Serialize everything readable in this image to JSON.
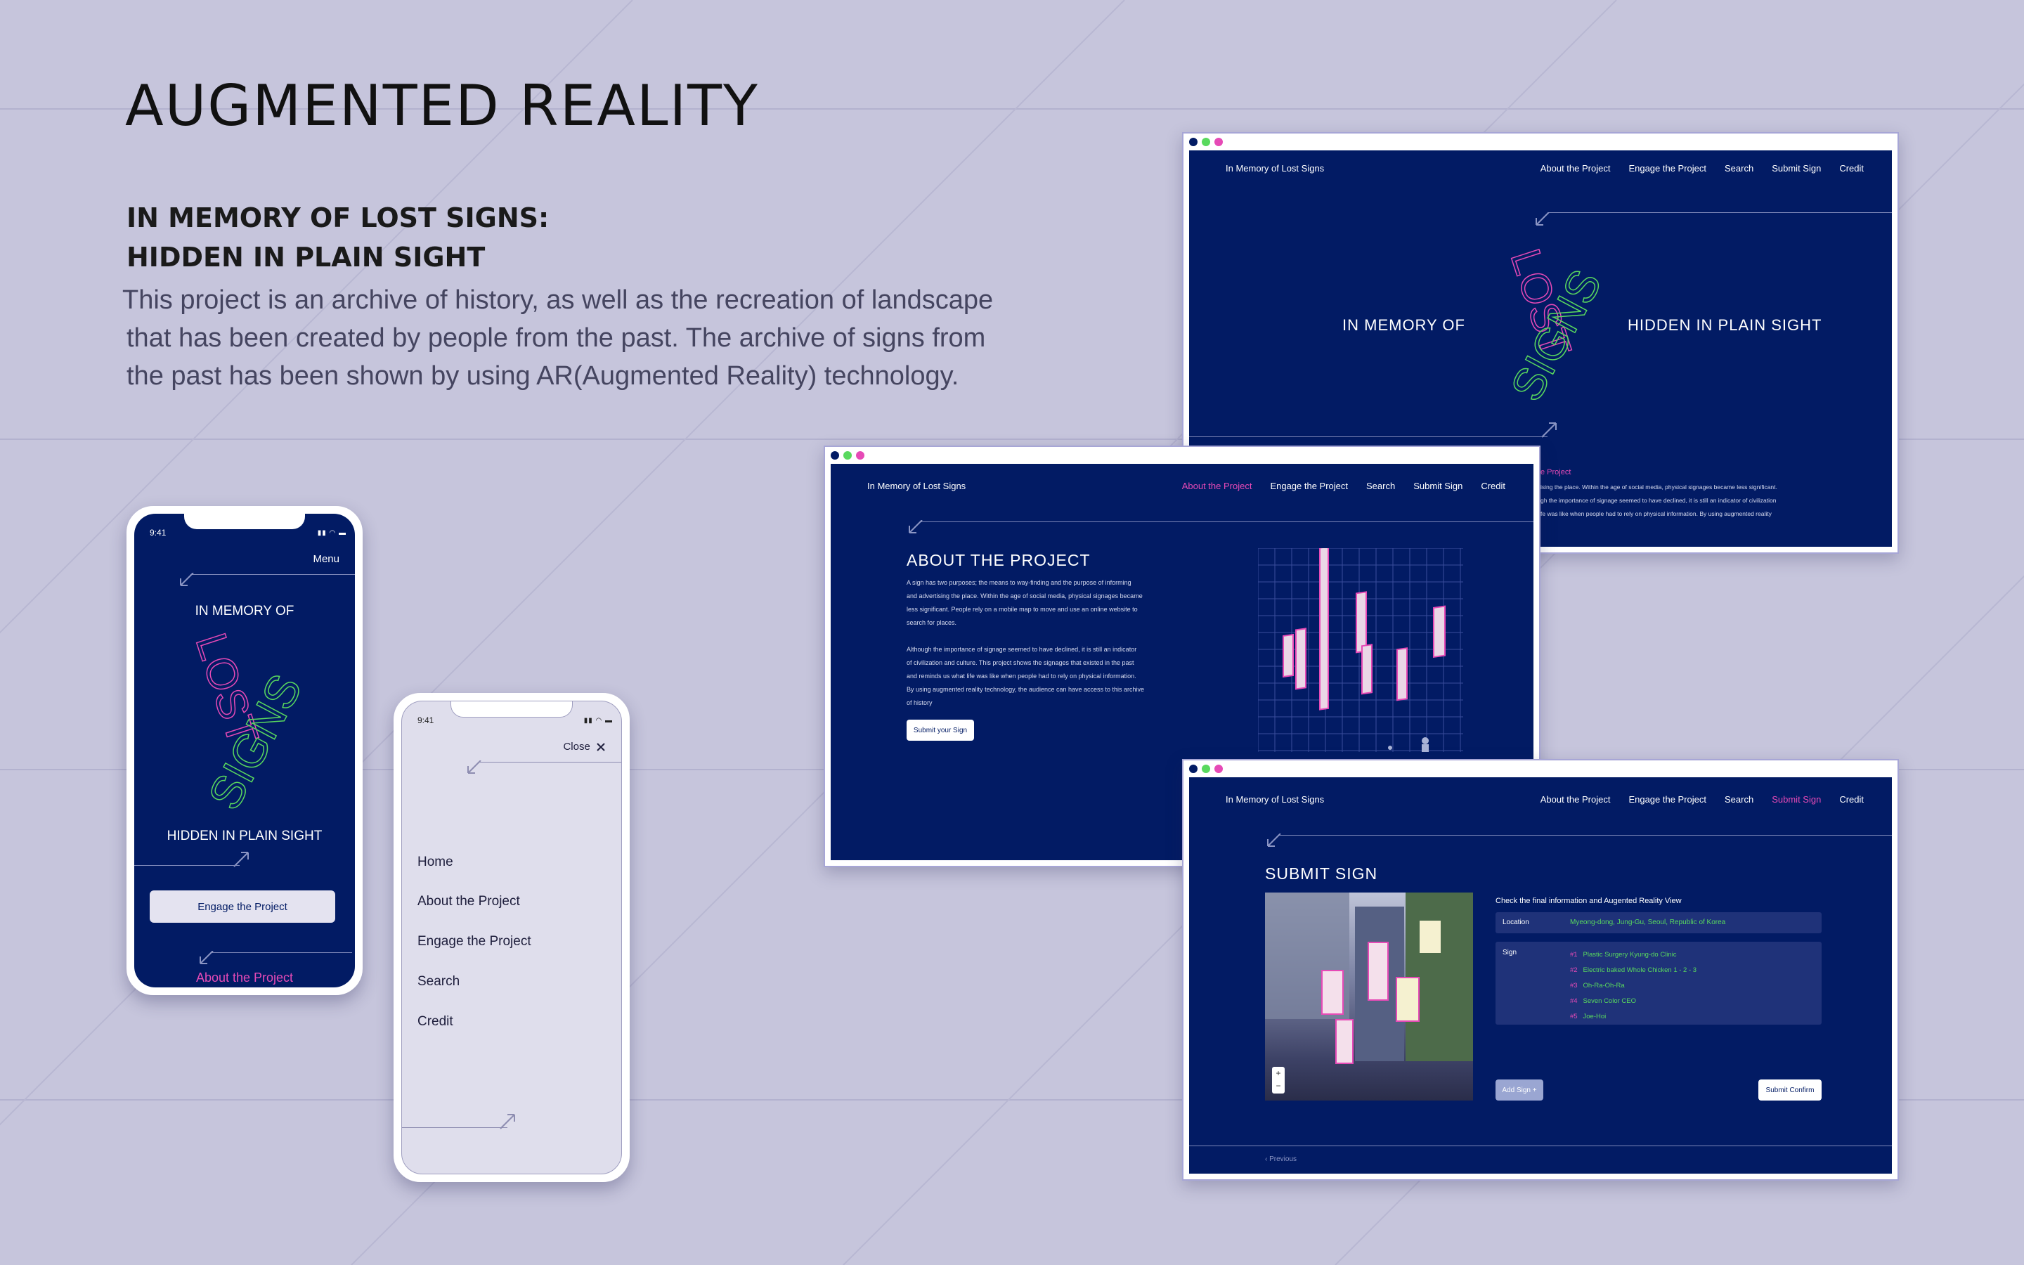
{
  "page": {
    "heading": "AUGMENTED REALITY",
    "subheading_line1": "IN MEMORY OF LOST SIGNS:",
    "subheading_line2": "HIDDEN IN PLAIN SIGHT",
    "description_line1": "This project is an archive of history, as well as the recreation of landscape",
    "description_line2": "that has been created by people from the past. The archive of signs from",
    "description_line3": "the past has been shown by using AR(Augmented Reality) technology."
  },
  "colors": {
    "background": "#c6c5dc",
    "navy": "#021b64",
    "pink": "#e64ab6",
    "green": "#59d95e"
  },
  "nav": {
    "brand": "In Memory of Lost Signs",
    "links": [
      "About the Project",
      "Engage the Project",
      "Search",
      "Submit Sign",
      "Credit"
    ]
  },
  "home_window": {
    "left_title": "IN MEMORY OF",
    "right_title": "HIDDEN IN PLAIN SIGHT",
    "logo_word1": "LOST",
    "logo_word2": "SIGNS",
    "peek_label": "e Project",
    "peek_line1": "ising the place. Within the age of social media, physical signages became less significant.",
    "peek_line2": "gh the importance of signage seemed to have declined, it is still an indicator of civilization",
    "peek_line3": "fe was like when people had to rely on physical information. By using augmented reality"
  },
  "about_window": {
    "title": "ABOUT THE PROJECT",
    "p1": [
      "A sign has two purposes; the means to way-finding and the purpose of informing",
      "and advertising the place. Within the age of social media, physical signages became",
      "less significant. People rely on a mobile map to move and use an online website to",
      "search for places."
    ],
    "p2": [
      "Although the importance of signage seemed to have declined, it is still an indicator",
      "of civilization and culture. This project shows the signages that existed in the past",
      "and reminds us what life was like when people had to rely on physical information.",
      "By using augmented reality technology, the audience can have access to this archive",
      "of history"
    ],
    "button": "Submit your Sign"
  },
  "submit_window": {
    "title": "SUBMIT SIGN",
    "check_label": "Check the final information and Augented Reality View",
    "location_label": "Location",
    "location_value": "Myeong-dong, Jung-Gu, Seoul, Republic of Korea",
    "sign_label": "Sign",
    "signs": [
      {
        "num": "#1",
        "name": "Plastic Surgery Kyung-do Clinic"
      },
      {
        "num": "#2",
        "name": "Electric baked Whole Chicken 1 - 2 - 3"
      },
      {
        "num": "#3",
        "name": "Oh-Ra-Oh-Ra"
      },
      {
        "num": "#4",
        "name": "Seven Color CEO"
      },
      {
        "num": "#5",
        "name": "Joe-Hoi"
      }
    ],
    "add_button": "Add Sign +",
    "confirm_button": "Submit Confirm",
    "previous": "‹ Previous",
    "zoom_in": "+",
    "zoom_out": "−"
  },
  "phone1": {
    "time": "9:41",
    "menu": "Menu",
    "title_top": "IN MEMORY OF",
    "title_bottom": "HIDDEN IN PLAIN SIGHT",
    "button": "Engage the Project",
    "peek": "About the Project"
  },
  "phone2": {
    "time": "9:41",
    "close": "Close",
    "items": [
      "Home",
      "About the Project",
      "Engage the Project",
      "Search",
      "Credit"
    ]
  }
}
